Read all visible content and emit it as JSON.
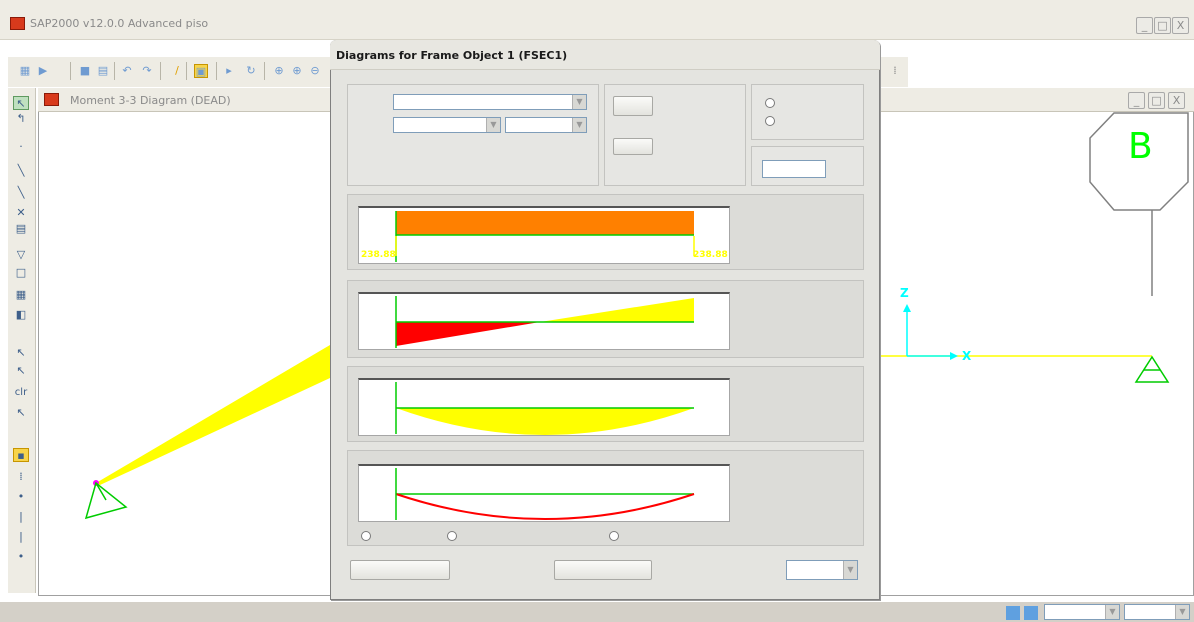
{
  "app": {
    "title": "SAP2000 v12.0.0 Advanced   piso"
  },
  "window_buttons": {
    "minimize": "_",
    "maximize": "□",
    "close": "X"
  },
  "child_window": {
    "title": "Moment 3-3 Diagram  (DEAD)"
  },
  "axis_labels": {
    "z": "Z",
    "x": "X"
  },
  "grid_marker": {
    "label": "B"
  },
  "left_toolbar": {
    "clr_label": "clr"
  },
  "dialog": {
    "title": "Diagrams for Frame Object 1  (FSEC1)",
    "loads_plot": {
      "left_value": "238.88",
      "right_value": "238.88"
    },
    "colors": {
      "dist_load": "#ff8000",
      "positive": "#ffff00",
      "negative": "#ff0000",
      "axis": "#00cc00"
    }
  },
  "colors": {
    "frame": "#ffff00",
    "support": "#00cc00",
    "axis": "#00ffff",
    "joint": "#ff00ff"
  }
}
